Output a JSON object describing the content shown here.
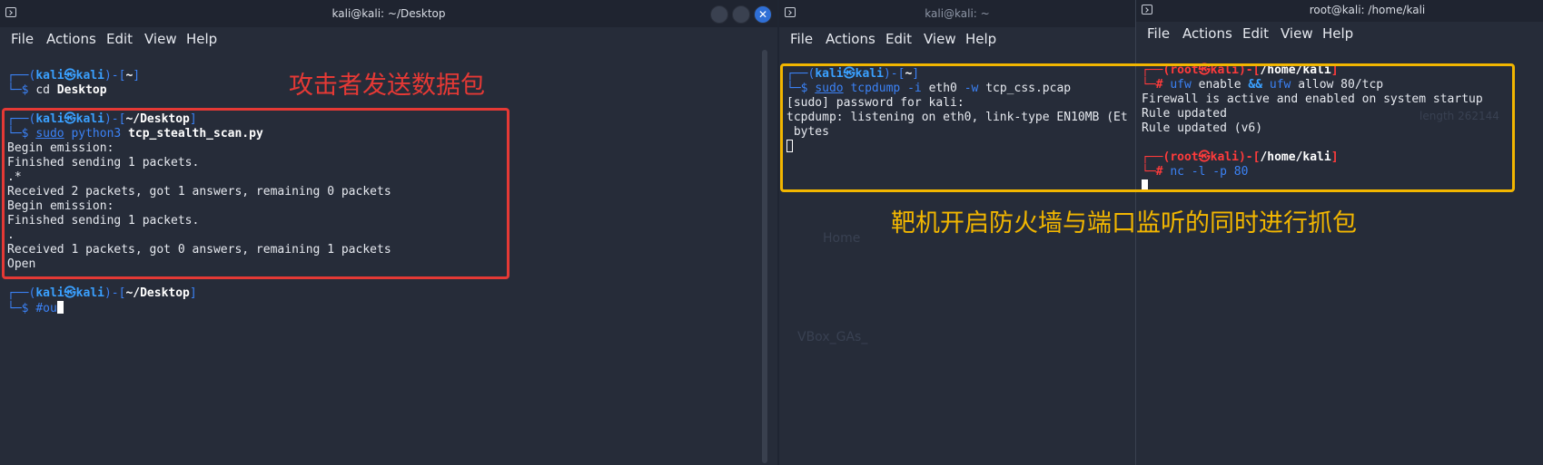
{
  "left_window": {
    "title": "kali@kali: ~/Desktop",
    "menu": [
      "File",
      "Actions",
      "Edit",
      "View",
      "Help"
    ],
    "annotation": "攻击者发送数据包",
    "lines": {
      "p1_user": "kali",
      "p1_at": "㉿",
      "p1_host": "kali",
      "p1_dir": "~",
      "cmd1": "cd Desktop",
      "cmd1_cmd": "cd",
      "cmd1_arg": "Desktop",
      "p2_user": "kali",
      "p2_host": "kali",
      "p2_dir": "~/Desktop",
      "cmd2_sudo": "sudo",
      "cmd2_prog": "python3",
      "cmd2_arg": "tcp_stealth_scan.py",
      "out1": "Begin emission:",
      "out2": "Finished sending 1 packets.",
      "out3": ".*",
      "out4": "Received 2 packets, got 1 answers, remaining 0 packets",
      "out5": "Begin emission:",
      "out6": "Finished sending 1 packets.",
      "out7": ".",
      "out8": "Received 1 packets, got 0 answers, remaining 1 packets",
      "out9": "Open",
      "p3_user": "kali",
      "p3_host": "kali",
      "p3_dir": "~/Desktop",
      "cmd3": "#ou"
    }
  },
  "middle_window": {
    "title": "kali@kali: ~",
    "menu": [
      "File",
      "Actions",
      "Edit",
      "View",
      "Help"
    ],
    "lines": {
      "p_user": "kali",
      "p_host": "kali",
      "p_dir": "~",
      "cmd_sudo": "sudo",
      "cmd_prog": "tcpdump",
      "cmd_args1": "-i",
      "cmd_eth": "eth0",
      "cmd_args2": "-w",
      "cmd_file": "tcp_css.pcap",
      "out1": "[sudo] password for kali:",
      "out2": "tcpdump: listening on eth0, link-type EN10MB (Et",
      "out3": " bytes"
    }
  },
  "right_window": {
    "title": "root@kali: /home/kali",
    "menu": [
      "File",
      "Actions",
      "Edit",
      "View",
      "Help"
    ],
    "lines": {
      "p1_user": "root",
      "p1_host": "kali",
      "p1_dir": "/home/kali",
      "cmd1_a": "ufw",
      "cmd1_b": "enable",
      "cmd1_and": "&&",
      "cmd1_c": "ufw",
      "cmd1_d": "allow 80/tcp",
      "out1": "Firewall is active and enabled on system startup",
      "out2": "Rule updated",
      "out3": "Rule updated (v6)",
      "p2_user": "root",
      "p2_host": "kali",
      "p2_dir": "/home/kali",
      "cmd2_a": "nc",
      "cmd2_b": "-l -p 80"
    }
  },
  "annotation_right": "靶机开启防火墙与端口监听的同时进行抓包",
  "ghost_text": {
    "a": "Home",
    "b": "VBox_GAs_",
    "c": "length 262144"
  },
  "colors": {
    "annotation_red": "#e53935",
    "annotation_yellow": "#f2b600",
    "prompt_blue": "#3b82f6",
    "root_red": "#ff3b3b"
  }
}
